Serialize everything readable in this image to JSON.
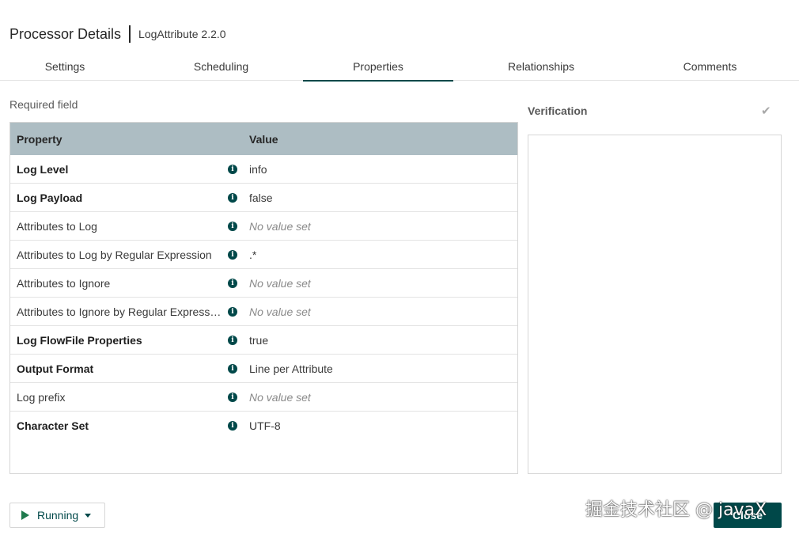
{
  "header": {
    "title": "Processor Details",
    "subtitle": "LogAttribute 2.2.0"
  },
  "tabs": [
    {
      "label": "Settings"
    },
    {
      "label": "Scheduling"
    },
    {
      "label": "Properties",
      "active": true
    },
    {
      "label": "Relationships"
    },
    {
      "label": "Comments"
    }
  ],
  "required_label": "Required field",
  "table": {
    "headers": {
      "property": "Property",
      "value": "Value"
    },
    "rows": [
      {
        "name": "Log Level",
        "value": "info",
        "required": true,
        "empty": false
      },
      {
        "name": "Log Payload",
        "value": "false",
        "required": true,
        "empty": false
      },
      {
        "name": "Attributes to Log",
        "value": "No value set",
        "required": false,
        "empty": true
      },
      {
        "name": "Attributes to Log by Regular Expression",
        "value": ".*",
        "required": false,
        "empty": false
      },
      {
        "name": "Attributes to Ignore",
        "value": "No value set",
        "required": false,
        "empty": true
      },
      {
        "name": "Attributes to Ignore by Regular Expression",
        "value": "No value set",
        "required": false,
        "empty": true
      },
      {
        "name": "Log FlowFile Properties",
        "value": "true",
        "required": true,
        "empty": false
      },
      {
        "name": "Output Format",
        "value": "Line per Attribute",
        "required": true,
        "empty": false
      },
      {
        "name": "Log prefix",
        "value": "No value set",
        "required": false,
        "empty": true
      },
      {
        "name": "Character Set",
        "value": "UTF-8",
        "required": true,
        "empty": false
      }
    ]
  },
  "verification": {
    "label": "Verification",
    "check_icon": "check-icon"
  },
  "footer": {
    "running_label": "Running",
    "close_label": "Close"
  },
  "watermark": "掘金技术社区 @ javaX",
  "colors": {
    "accent": "#004849",
    "header_bg": "#adbdc3",
    "play": "#1f7a4d"
  }
}
